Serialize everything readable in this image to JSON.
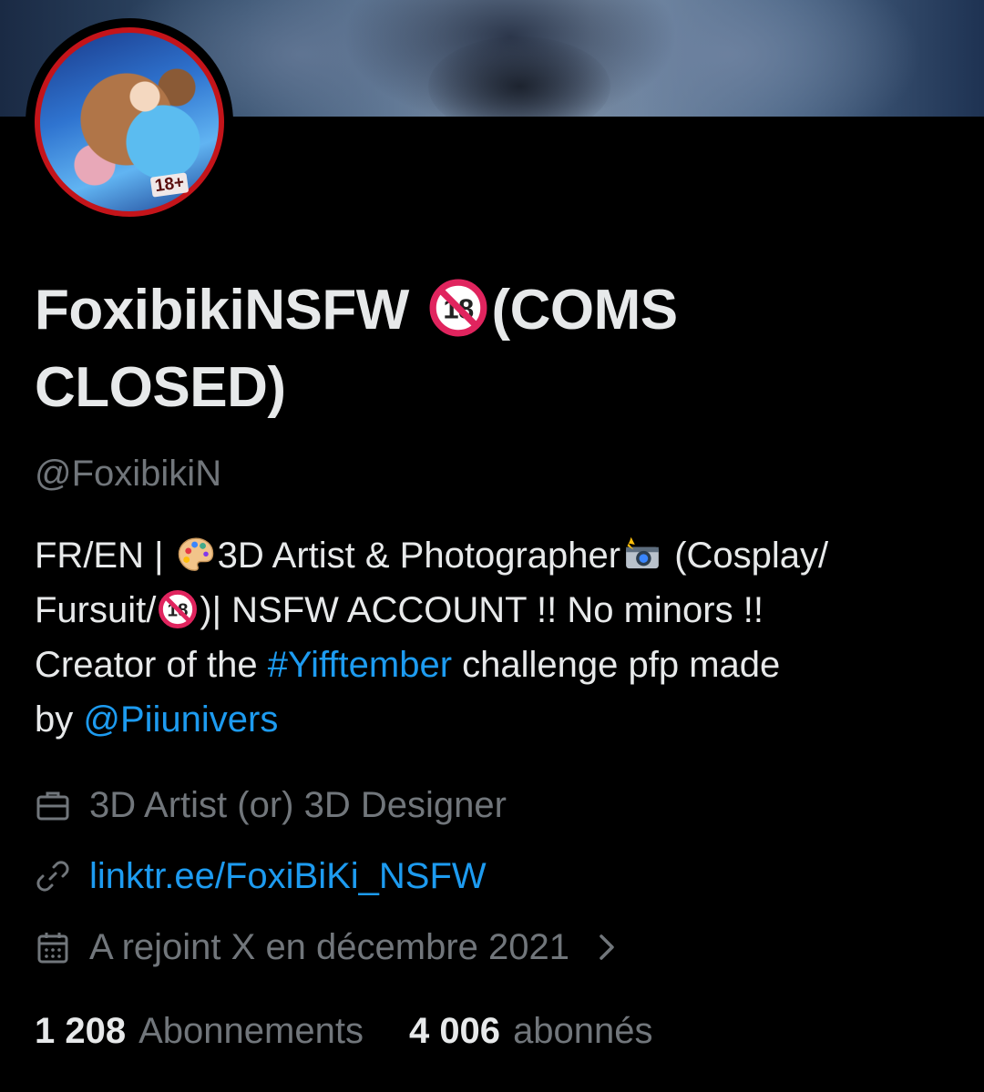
{
  "profile": {
    "display_name_part1": "FoxibikiNSFW ",
    "display_name_part2": "(COMS\nCLOSED)",
    "handle": "@FoxibikiN",
    "avatar_badge": "18+"
  },
  "bio": {
    "line1_a": "FR/EN | ",
    "line1_b": "3D Artist & Photographer",
    "line1_c": " (Cosplay/",
    "line2_a": "Fursuit/",
    "line2_b": ")| NSFW ACCOUNT !! No minors !!",
    "line3_a": "Creator of the ",
    "line3_hashtag": "#Yifftember",
    "line3_b": " challenge pfp made",
    "line4_a": "by ",
    "line4_mention": "@Piiunivers"
  },
  "meta": {
    "job": "3D Artist (or) 3D Designer",
    "link": "linktr.ee/FoxiBiKi_NSFW",
    "joined": "A rejoint X en décembre 2021"
  },
  "stats": {
    "following_count": "1 208",
    "following_label": "Abonnements",
    "followers_count": "4 006",
    "followers_label": "abonnés"
  },
  "colors": {
    "background": "#000000",
    "primary_text": "#e7e9ea",
    "secondary_text": "#71767b",
    "link": "#1d9bf0",
    "avatar_ring": "#c4141a"
  },
  "icons": {
    "job": "briefcase-icon",
    "link": "link-icon",
    "joined": "calendar-icon",
    "chevron": "chevron-right-icon",
    "no_minors_emoji": "no-one-under-eighteen-icon",
    "palette_emoji": "artist-palette-icon",
    "camera_emoji": "camera-with-flash-icon"
  }
}
